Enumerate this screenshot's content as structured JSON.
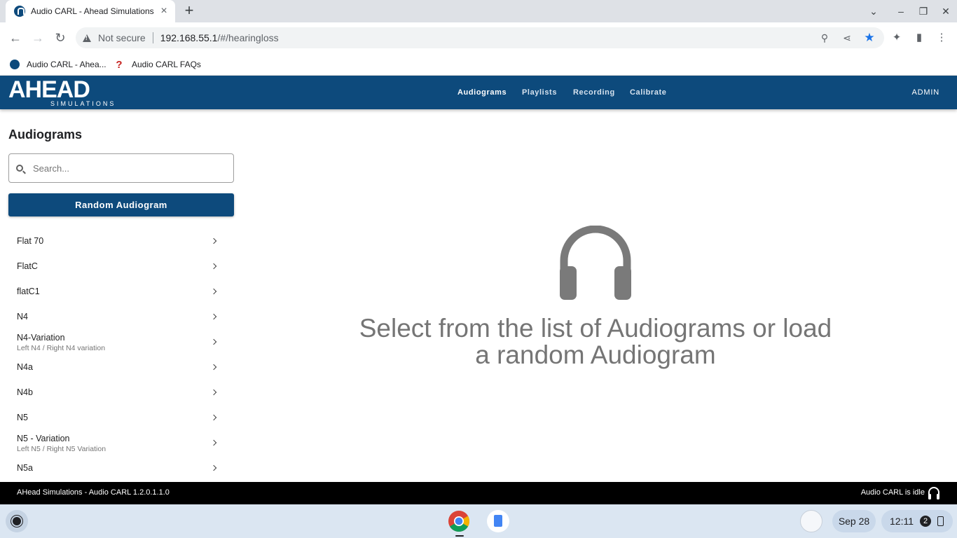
{
  "browser": {
    "tab_title": "Audio CARL - Ahead Simulations",
    "security_label": "Not secure",
    "url_host": "192.168.55.1",
    "url_path": "/#/hearingloss",
    "bookmarks": [
      {
        "label": "Audio CARL - Ahea..."
      },
      {
        "label": "Audio CARL FAQs"
      }
    ],
    "colors": {
      "star": "#1a73e8",
      "faq_icon": "#c5221f"
    }
  },
  "app": {
    "logo_text": "AHEAD",
    "logo_subtext": "SIMULATIONS",
    "nav": [
      {
        "label": "Audiograms",
        "active": true
      },
      {
        "label": "Playlists",
        "active": false
      },
      {
        "label": "Recording",
        "active": false
      },
      {
        "label": "Calibrate",
        "active": false
      }
    ],
    "admin_label": "ADMIN",
    "brand_color": "#0d4a7c"
  },
  "sidebar": {
    "title": "Audiograms",
    "search_placeholder": "Search...",
    "random_button": "Random Audiogram",
    "items": [
      {
        "label": "Flat 70",
        "sub": ""
      },
      {
        "label": "FlatC",
        "sub": ""
      },
      {
        "label": "flatC1",
        "sub": ""
      },
      {
        "label": "N4",
        "sub": ""
      },
      {
        "label": "N4-Variation",
        "sub": "Left N4 / Right N4 variation"
      },
      {
        "label": "N4a",
        "sub": ""
      },
      {
        "label": "N4b",
        "sub": ""
      },
      {
        "label": "N5",
        "sub": ""
      },
      {
        "label": "N5 - Variation",
        "sub": "Left N5 / Right N5 Variation"
      },
      {
        "label": "N5a",
        "sub": ""
      }
    ]
  },
  "main": {
    "prompt": "Select from the list of Audiograms or load a random Audiogram",
    "icon": "headphones-icon"
  },
  "footer": {
    "version": "AHead Simulations - Audio CARL 1.2.0.1.1.0",
    "status": "Audio CARL is idle"
  },
  "shelf": {
    "date": "Sep 28",
    "time": "12:11",
    "notification_count": "2"
  }
}
